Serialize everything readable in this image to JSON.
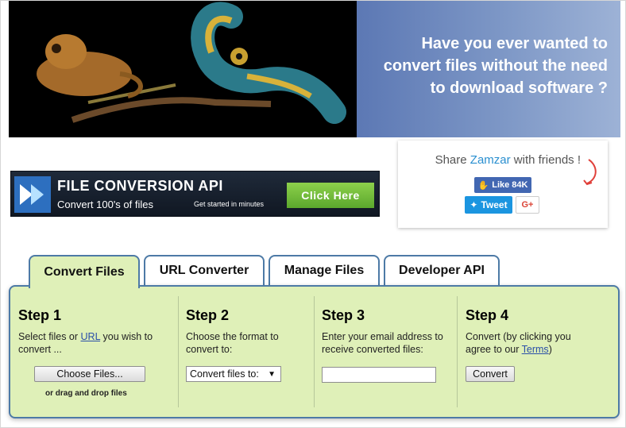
{
  "hero": {
    "headline_line1": "Have you ever wanted to",
    "headline_line2": "convert files without the need",
    "headline_line3": "to download software ?"
  },
  "share": {
    "prefix": "Share ",
    "brand": "Zamzar",
    "suffix": " with friends !",
    "like_label": "Like 84K",
    "tweet_label": "Tweet",
    "gplus_label": "G+"
  },
  "ad": {
    "title": "FILE CONVERSION API",
    "subtitle": "Convert 100's of files",
    "small": "Get started in minutes",
    "cta": "Click Here"
  },
  "tabs": [
    {
      "label": "Convert Files",
      "active": true
    },
    {
      "label": "URL Converter",
      "active": false
    },
    {
      "label": "Manage Files",
      "active": false
    },
    {
      "label": "Developer API",
      "active": false
    }
  ],
  "steps": [
    {
      "title": "Step 1",
      "text_a": "Select files or ",
      "link": "URL",
      "text_b": " you wish to convert ...",
      "button": "Choose Files...",
      "note": "or drag and drop files"
    },
    {
      "title": "Step 2",
      "text": "Choose the format to convert to:",
      "select": "Convert files to:"
    },
    {
      "title": "Step 3",
      "text": "Enter your email address to receive converted files:",
      "input_value": ""
    },
    {
      "title": "Step 4",
      "text_a": "Convert (by clicking you agree to our ",
      "link": "Terms",
      "text_b": ")",
      "button": "Convert"
    }
  ],
  "colors": {
    "panel_bg": "#dff0b8",
    "panel_border": "#4d7aa6",
    "brand_blue": "#2a8fd0",
    "facebook": "#4267b2",
    "twitter": "#1b95e0"
  }
}
